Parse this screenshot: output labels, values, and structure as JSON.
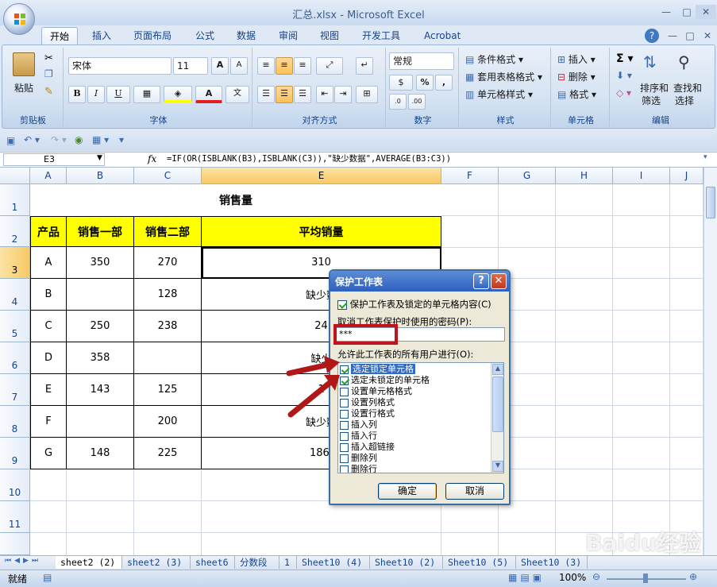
{
  "window": {
    "title": "汇总.xlsx - Microsoft Excel",
    "controls": [
      "—",
      "□",
      "✕"
    ],
    "sub_controls": [
      "?",
      "—",
      "□",
      "✕"
    ]
  },
  "tabs": [
    "开始",
    "插入",
    "页面布局",
    "公式",
    "数据",
    "审阅",
    "视图",
    "开发工具",
    "Acrobat"
  ],
  "ribbon": {
    "clipboard": {
      "paste": "粘贴",
      "label": "剪贴板"
    },
    "font": {
      "name": "宋体",
      "size": "11",
      "bold": "B",
      "italic": "I",
      "underline": "U",
      "label": "字体"
    },
    "align": {
      "label": "对齐方式"
    },
    "number": {
      "format": "常规",
      "percent": "%",
      "comma": ",",
      "label": "数字"
    },
    "styles": {
      "cond": "条件格式",
      "table": "套用表格格式",
      "cell": "单元格样式",
      "label": "样式"
    },
    "cells": {
      "insert": "插入",
      "delete": "删除",
      "format": "格式",
      "label": "单元格"
    },
    "edit": {
      "sort1": "排序和",
      "sort2": "筛选",
      "find1": "查找和",
      "find2": "选择",
      "label": "编辑"
    }
  },
  "formula_bar": {
    "name_box": "E3",
    "fx": "fx",
    "formula": "=IF(OR(ISBLANK(B3),ISBLANK(C3)),\"缺少数据\",AVERAGE(B3:C3))"
  },
  "columns": [
    "A",
    "B",
    "C",
    "E",
    "F",
    "G",
    "H",
    "I",
    "J"
  ],
  "rows": [
    "1",
    "2",
    "3",
    "4",
    "5",
    "6",
    "7",
    "8",
    "9",
    "10",
    "11"
  ],
  "sheet": {
    "title": "销售量",
    "headers": [
      "产品",
      "销售一部",
      "销售二部",
      "平均销量"
    ],
    "data": [
      [
        "A",
        "350",
        "270",
        "310"
      ],
      [
        "B",
        "",
        "128",
        "缺少数"
      ],
      [
        "C",
        "250",
        "238",
        "24"
      ],
      [
        "D",
        "358",
        "",
        "缺少"
      ],
      [
        "E",
        "143",
        "125",
        "1"
      ],
      [
        "F",
        "",
        "200",
        "缺少数"
      ],
      [
        "G",
        "148",
        "225",
        "186."
      ]
    ]
  },
  "sheet_tabs": [
    "sheet2 (2)",
    "sheet2 (3)",
    "sheet6",
    "分数段",
    "1",
    "Sheet10 (4)",
    "Sheet10 (2)",
    "Sheet10 (5)",
    "Sheet10 (3)"
  ],
  "status": {
    "ready": "就绪",
    "zoom": "100%"
  },
  "dialog": {
    "title": "保护工作表",
    "protect_label": "保护工作表及锁定的单元格内容(C)",
    "password_label": "取消工作表保护时使用的密码(P):",
    "password_value": "***",
    "allow_label": "允许此工作表的所有用户进行(O):",
    "options": [
      {
        "label": "选定锁定单元格",
        "checked": true
      },
      {
        "label": "选定未锁定的单元格",
        "checked": true
      },
      {
        "label": "设置单元格格式",
        "checked": false
      },
      {
        "label": "设置列格式",
        "checked": false
      },
      {
        "label": "设置行格式",
        "checked": false
      },
      {
        "label": "插入列",
        "checked": false
      },
      {
        "label": "插入行",
        "checked": false
      },
      {
        "label": "插入超链接",
        "checked": false
      },
      {
        "label": "删除列",
        "checked": false
      },
      {
        "label": "删除行",
        "checked": false
      }
    ],
    "ok": "确定",
    "cancel": "取消"
  },
  "watermark": "Baidu经验",
  "colors": {
    "header_fill": "#ffff00",
    "accent": "#316ac5",
    "arrow": "#b01818"
  }
}
